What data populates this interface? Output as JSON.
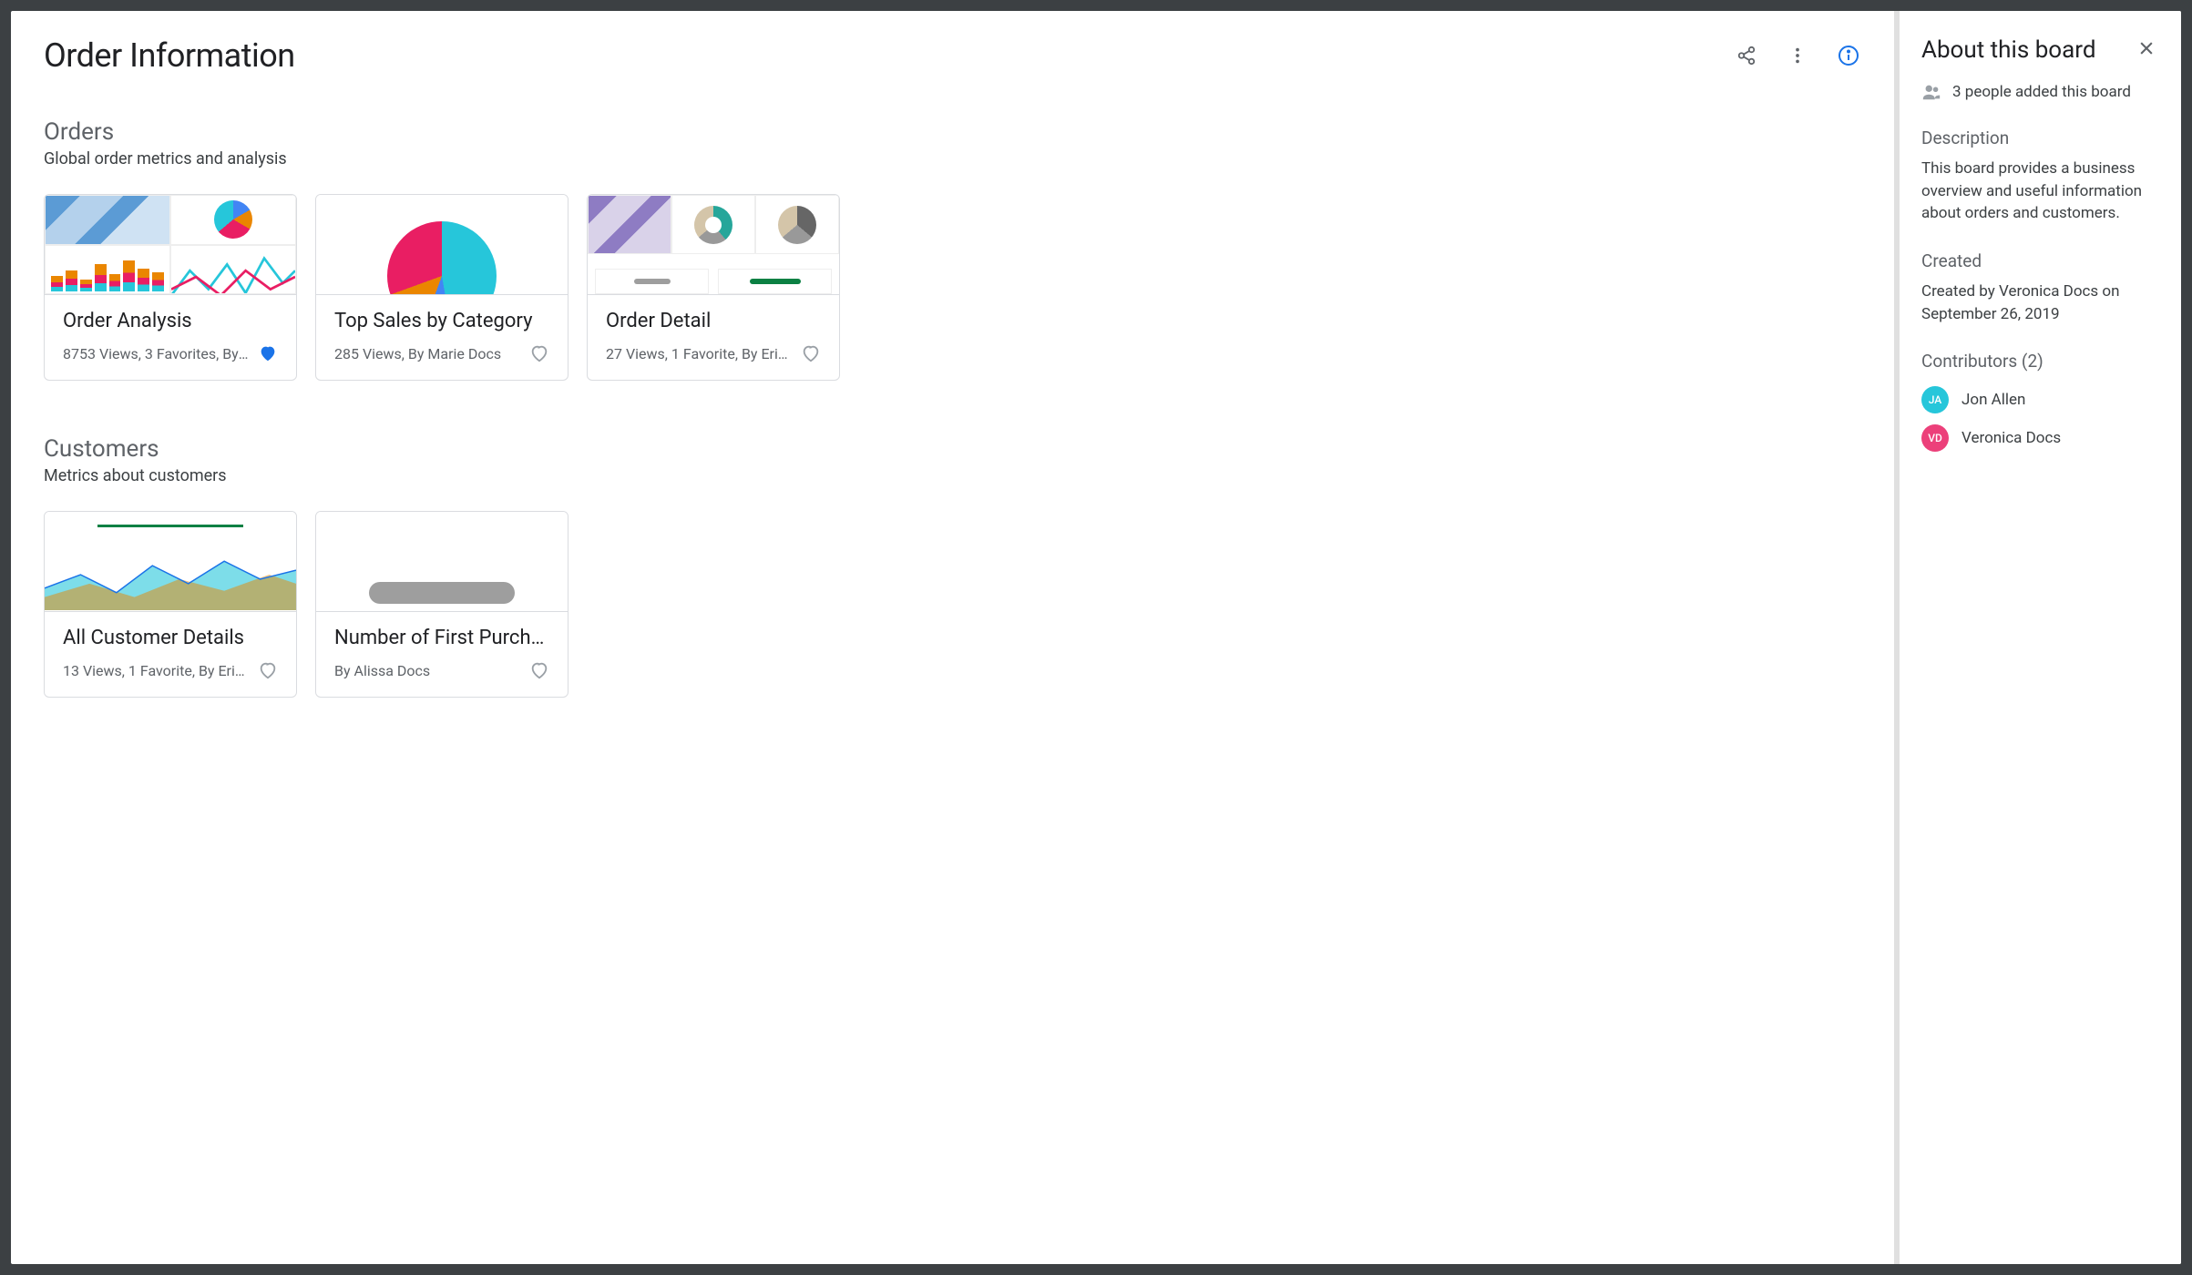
{
  "header": {
    "title": "Order Information"
  },
  "sections": [
    {
      "title": "Orders",
      "subtitle": "Global order metrics and analysis",
      "cards": [
        {
          "title": "Order Analysis",
          "meta": "8753 Views, 3 Favorites, By M…",
          "favorited": true
        },
        {
          "title": "Top Sales by Category",
          "meta": "285 Views, By Marie Docs",
          "favorited": false
        },
        {
          "title": "Order Detail",
          "meta": "27 Views, 1 Favorite, By Erin …",
          "favorited": false
        }
      ]
    },
    {
      "title": "Customers",
      "subtitle": "Metrics about customers",
      "cards": [
        {
          "title": "All Customer Details",
          "meta": "13 Views, 1 Favorite, By Erin …",
          "favorited": false
        },
        {
          "title": "Number of First Purcha…",
          "meta": "By Alissa Docs",
          "favorited": false
        }
      ]
    }
  ],
  "sidebar": {
    "title": "About this board",
    "people_text": "3 people added this board",
    "description_label": "Description",
    "description": "This board provides a business overview and useful information about orders and customers.",
    "created_label": "Created",
    "created_text": "Created by Veronica Docs on September 26, 2019",
    "contributors_label": "Contributors (2)",
    "contributors": [
      {
        "initials": "JA",
        "name": "Jon Allen",
        "color": "teal"
      },
      {
        "initials": "VD",
        "name": "Veronica Docs",
        "color": "pink"
      }
    ]
  }
}
